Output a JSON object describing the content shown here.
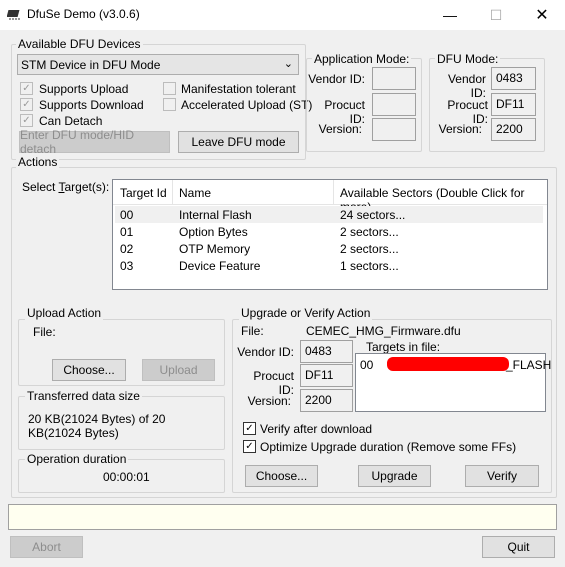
{
  "window": {
    "title": "DfuSe Demo (v3.0.6)",
    "minimize_icon": "minimize-icon",
    "maximize_icon": "maximize-icon",
    "close_icon": "close-icon"
  },
  "devices": {
    "group_label": "Available DFU Devices",
    "selected_device": "STM Device in DFU Mode",
    "checkboxes": [
      {
        "label": "Supports Upload",
        "checked": true
      },
      {
        "label": "Supports Download",
        "checked": true
      },
      {
        "label": "Can Detach",
        "checked": true
      },
      {
        "label": "Manifestation tolerant",
        "checked": false
      },
      {
        "label": "Accelerated Upload (ST)",
        "checked": false
      }
    ],
    "enter_dfu_btn": "Enter DFU mode/HID detach",
    "leave_dfu_btn": "Leave DFU mode"
  },
  "app_mode": {
    "group_label": "Application Mode:",
    "vendor_label": "Vendor ID:",
    "product_label": "Procuct ID:",
    "version_label": "Version:",
    "vendor_value": "",
    "product_value": "",
    "version_value": ""
  },
  "dfu_mode": {
    "group_label": "DFU Mode:",
    "vendor_label": "Vendor ID:",
    "product_label": "Procuct ID:",
    "version_label": "Version:",
    "vendor_value": "0483",
    "product_value": "DF11",
    "version_value": "2200"
  },
  "actions": {
    "group_label": "Actions",
    "select_targets_label": "Select Target(s):",
    "columns": [
      "Target Id",
      "Name",
      "Available Sectors (Double Click for more)"
    ],
    "rows": [
      {
        "id": "00",
        "name": "Internal Flash",
        "sectors": "24 sectors..."
      },
      {
        "id": "01",
        "name": "Option Bytes",
        "sectors": "2 sectors..."
      },
      {
        "id": "02",
        "name": "OTP Memory",
        "sectors": "2 sectors..."
      },
      {
        "id": "03",
        "name": "Device Feature",
        "sectors": "1 sectors..."
      }
    ]
  },
  "upload": {
    "group_label": "Upload Action",
    "file_label": "File:",
    "choose_btn": "Choose...",
    "upload_btn": "Upload"
  },
  "transferred": {
    "group_label": "Transferred data size",
    "value": "20 KB(21024 Bytes) of 20 KB(21024 Bytes)"
  },
  "duration": {
    "group_label": "Operation duration",
    "value": "00:00:01"
  },
  "upgrade": {
    "group_label": "Upgrade or Verify Action",
    "file_label": "File:",
    "file_name": "CEMEC_HMG_Firmware.dfu",
    "vendor_label": "Vendor ID:",
    "product_label": "Procuct ID:",
    "version_label": "Version:",
    "vendor_value": "0483",
    "product_value": "DF11",
    "version_value": "2200",
    "targets_label": "Targets in file:",
    "target_id": "00",
    "target_suffix": "_FLASH",
    "verify_after_download": "Verify after download",
    "optimize_upgrade": "Optimize Upgrade duration (Remove some FFs)",
    "choose_btn": "Choose...",
    "upgrade_btn": "Upgrade",
    "verify_btn": "Verify"
  },
  "status_text": "",
  "bottom": {
    "abort_btn": "Abort",
    "quit_btn": "Quit"
  }
}
